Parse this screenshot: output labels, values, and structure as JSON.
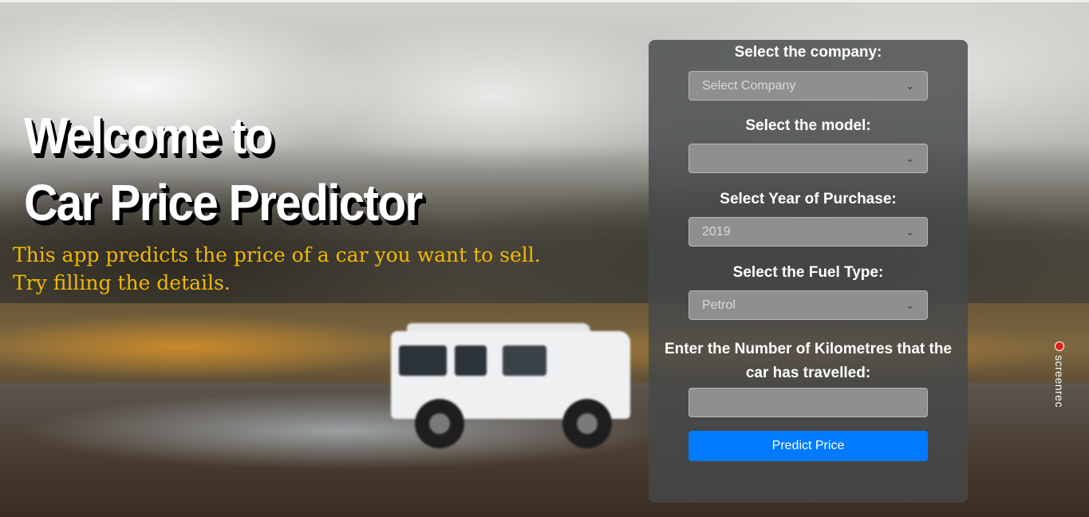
{
  "hero": {
    "title_line1": "Welcome to",
    "title_line2": "Car Price Predictor",
    "subtitle_line1": "This app predicts the price of a car you want to sell.",
    "subtitle_line2": "Try filling the details."
  },
  "form": {
    "company_label": "Select the company:",
    "company_value": "Select Company",
    "model_label": "Select the model:",
    "model_value": "",
    "year_label": "Select Year of Purchase:",
    "year_value": "2019",
    "fuel_label": "Select the Fuel Type:",
    "fuel_value": "Petrol",
    "kms_label": "Enter the Number of Kilometres that the car has travelled:",
    "kms_value": "",
    "predict_label": "Predict Price"
  },
  "overlay": {
    "screenrec_label": "screenrec"
  },
  "colors": {
    "accent": "#007bff",
    "subtitle": "#f2b705",
    "panel": "#46484b"
  },
  "icons": [
    "chevron-down-icon",
    "record-dot-icon"
  ]
}
